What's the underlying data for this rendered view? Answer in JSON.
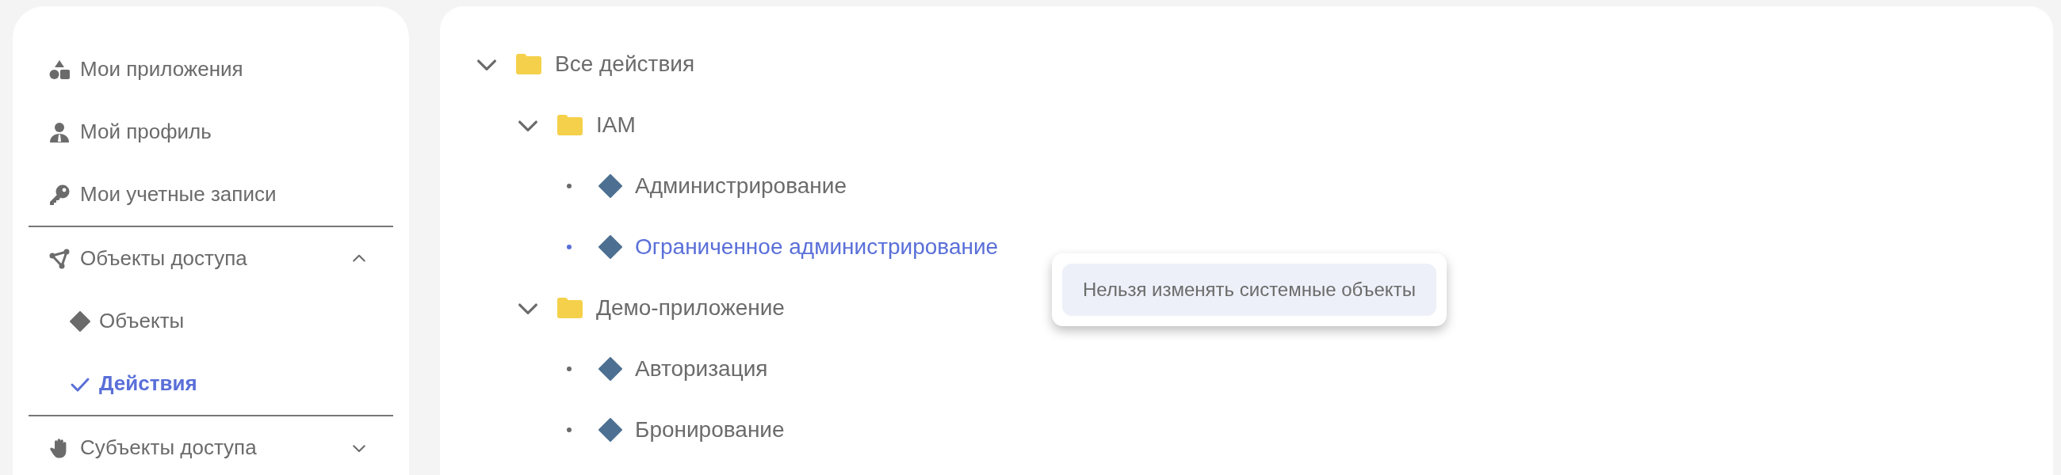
{
  "sidebar": {
    "items": [
      {
        "label": "Мои приложения"
      },
      {
        "label": "Мой профиль"
      },
      {
        "label": "Мои учетные записи"
      }
    ],
    "sections": [
      {
        "label": "Объекты доступа",
        "expanded": true,
        "children": [
          {
            "label": "Объекты",
            "selected": false
          },
          {
            "label": "Действия",
            "selected": true
          }
        ]
      },
      {
        "label": "Субъекты доступа",
        "expanded": false
      }
    ]
  },
  "tree": {
    "items": [
      {
        "kind": "folder",
        "label": "Все действия",
        "expanded": true,
        "children": [
          {
            "kind": "folder",
            "label": "IAM",
            "expanded": true,
            "children": [
              {
                "kind": "action",
                "label": "Администрирование",
                "selected": false
              },
              {
                "kind": "action",
                "label": "Ограниченное администрирование",
                "selected": true
              }
            ]
          },
          {
            "kind": "folder",
            "label": "Демо-приложение",
            "expanded": true,
            "children": [
              {
                "kind": "action",
                "label": "Авторизация",
                "selected": false
              },
              {
                "kind": "action",
                "label": "Бронирование",
                "selected": false
              }
            ]
          }
        ]
      }
    ]
  },
  "tooltip": {
    "text": "Нельзя изменять системные объекты"
  }
}
